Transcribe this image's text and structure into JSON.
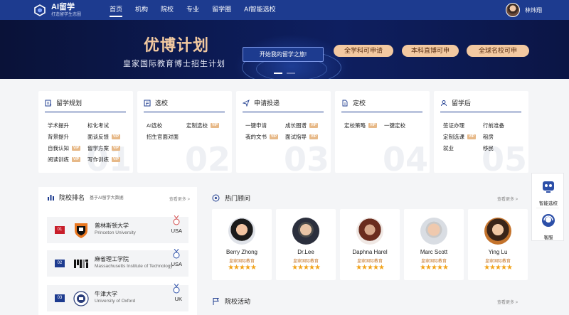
{
  "nav": {
    "logo_title": "AI留学",
    "logo_sub": "打造留学生态圈",
    "items": [
      {
        "label": "首页",
        "active": true
      },
      {
        "label": "机构",
        "active": false
      },
      {
        "label": "院校",
        "active": false
      },
      {
        "label": "专业",
        "active": false
      },
      {
        "label": "留学圈",
        "active": false
      },
      {
        "label": "AI智能选校",
        "active": false
      }
    ],
    "user_name": "林炜翔"
  },
  "banner": {
    "title": "优博计划",
    "subtitle": "皇家国际教育博士招生计划",
    "cta": "开始我的留学之旅!",
    "pills": [
      "全学科可申请",
      "本科直博可申",
      "全球名校可申"
    ]
  },
  "categories": [
    {
      "title": "留学规划",
      "num": "01",
      "icon": "planning-icon",
      "links": [
        {
          "label": "学术提升",
          "vip": false
        },
        {
          "label": "标化考试",
          "vip": false
        },
        {
          "label": "背景提升",
          "vip": false
        },
        {
          "label": "面谈反馈",
          "vip": true
        },
        {
          "label": "自我认知",
          "vip": true
        },
        {
          "label": "留学方案",
          "vip": true
        },
        {
          "label": "阅读训练",
          "vip": true
        },
        {
          "label": "写作训练",
          "vip": true
        }
      ]
    },
    {
      "title": "选校",
      "num": "02",
      "icon": "school-icon",
      "links": [
        {
          "label": "AI选校",
          "vip": false
        },
        {
          "label": "定制选校",
          "vip": true
        },
        {
          "label": "招生官面对面",
          "vip": false
        }
      ]
    },
    {
      "title": "申请投递",
      "num": "03",
      "icon": "send-icon",
      "links": [
        {
          "label": "一键申请",
          "vip": false
        },
        {
          "label": "成长图谱",
          "vip": true
        },
        {
          "label": "我的文书",
          "vip": true
        },
        {
          "label": "面试指导",
          "vip": true
        }
      ]
    },
    {
      "title": "定校",
      "num": "04",
      "icon": "document-icon",
      "links": [
        {
          "label": "定校策略",
          "vip": true
        },
        {
          "label": "一键定校",
          "vip": false
        }
      ]
    },
    {
      "title": "留学后",
      "num": "05",
      "icon": "person-icon",
      "links": [
        {
          "label": "签证办理",
          "vip": false
        },
        {
          "label": "行前准备",
          "vip": false
        },
        {
          "label": "定制选课",
          "vip": true
        },
        {
          "label": "租房",
          "vip": false
        },
        {
          "label": "就业",
          "vip": false
        },
        {
          "label": "移民",
          "vip": false
        }
      ]
    }
  ],
  "ranking": {
    "title": "院校排名",
    "tag": "基于AI留学大数据",
    "more": "查看更多 >",
    "universities": [
      {
        "rank": "01",
        "cn": "普林斯顿大学",
        "en": "Princeton University",
        "country": "USA",
        "medal": "01"
      },
      {
        "rank": "02",
        "cn": "麻省理工学院",
        "en": "Massachusetts Institute of Technology",
        "country": "USA",
        "medal": "02"
      },
      {
        "rank": "03",
        "cn": "牛津大学",
        "en": "University of Oxford",
        "country": "UK",
        "medal": "03"
      }
    ]
  },
  "consultants": {
    "title": "热门顾问",
    "more": "查看更多 >",
    "items": [
      {
        "name": "Berry Zhong",
        "org": "皇家国际教育",
        "stars": "★★★★★"
      },
      {
        "name": "Dr.Lee",
        "org": "皇家国际教育",
        "stars": "★★★★★"
      },
      {
        "name": "Daphna Harel",
        "org": "皇家国际教育",
        "stars": "★★★★★"
      },
      {
        "name": "Marc Scott",
        "org": "皇家国际教育",
        "stars": "★★★★★"
      },
      {
        "name": "Ying Lu",
        "org": "皇家国际教育",
        "stars": "★★★★★"
      }
    ]
  },
  "activities": {
    "title": "院校活动",
    "more": "查看更多 >"
  },
  "side": {
    "ai_label": "智能选校",
    "service_label": "客服"
  },
  "colors": {
    "primary": "#1d3b8f",
    "accent": "#f3c9a1",
    "vip": "#e7b988",
    "star": "#f2a31a",
    "rank_red": "#c81e2a"
  }
}
